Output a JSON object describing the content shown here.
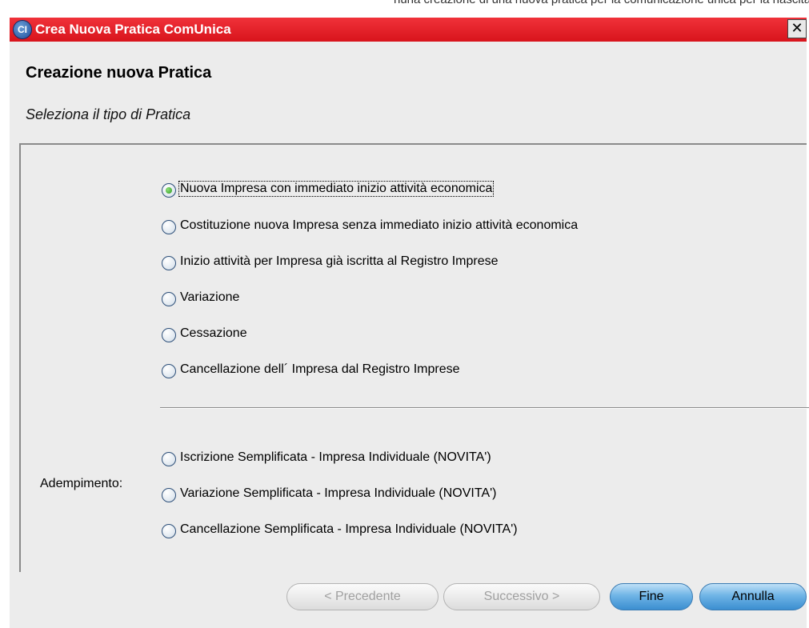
{
  "window": {
    "title": "Crea Nuova Pratica ComUnica",
    "icon_text": "CI",
    "close_symbol": "✕"
  },
  "background_fragment": "nuna creazione di una nuova pratica per la comunicazione unica per la nascita dell'impresa e per la gestione di una pratica",
  "header": {
    "title": "Creazione nuova Pratica",
    "subtitle": "Seleziona il tipo di Pratica"
  },
  "form": {
    "field_label": "Adempimento:",
    "selected_index": 0,
    "options": [
      "Nuova Impresa con immediato inizio attività economica",
      "Costituzione nuova Impresa senza immediato inizio attività economica",
      "Inizio attività per Impresa già iscritta al Registro Imprese",
      "Variazione",
      "Cessazione",
      "Cancellazione dell´ Impresa dal Registro Imprese",
      "Iscrizione Semplificata - Impresa Individuale (NOVITA')",
      "Variazione Semplificata - Impresa Individuale  (NOVITA')",
      "Cancellazione Semplificata - Impresa Individuale  (NOVITA')"
    ]
  },
  "buttons": {
    "previous": "< Precedente",
    "next": "Successivo >",
    "finish": "Fine",
    "cancel": "Annulla"
  },
  "colors": {
    "titlebar": "#e01c24",
    "dialog_background": "#ececec",
    "primary_button": "#5aa7e0",
    "radio_selected": "#3aa52a"
  }
}
